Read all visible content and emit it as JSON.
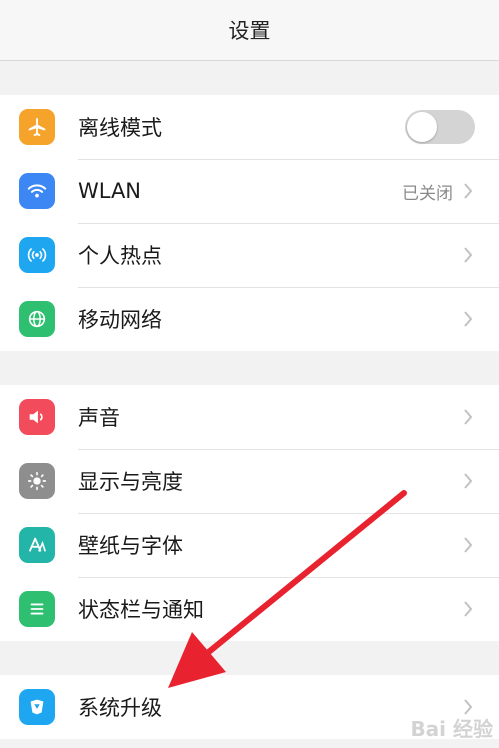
{
  "header": {
    "title": "设置"
  },
  "groups": [
    {
      "items": [
        {
          "label": "离线模式",
          "icon": "airplane-icon",
          "icon_color": "#f5a32b",
          "control": "toggle",
          "toggle_on": false
        },
        {
          "label": "WLAN",
          "icon": "wifi-icon",
          "icon_color": "#3d87f5",
          "value": "已关闭"
        },
        {
          "label": "个人热点",
          "icon": "hotspot-icon",
          "icon_color": "#1ea7f0"
        },
        {
          "label": "移动网络",
          "icon": "globe-icon",
          "icon_color": "#2fbf71"
        }
      ]
    },
    {
      "items": [
        {
          "label": "声音",
          "icon": "speaker-icon",
          "icon_color": "#f24b5b"
        },
        {
          "label": "显示与亮度",
          "icon": "brightness-icon",
          "icon_color": "#8e8e8e"
        },
        {
          "label": "壁纸与字体",
          "icon": "font-icon",
          "icon_color": "#22b5a8"
        },
        {
          "label": "状态栏与通知",
          "icon": "notification-list-icon",
          "icon_color": "#2fbf71"
        }
      ]
    },
    {
      "items": [
        {
          "label": "系统升级",
          "icon": "system-update-icon",
          "icon_color": "#1ea7f0"
        }
      ]
    }
  ],
  "annotation": {
    "arrow_color": "#e8232f"
  },
  "watermark": "Bai 经验"
}
